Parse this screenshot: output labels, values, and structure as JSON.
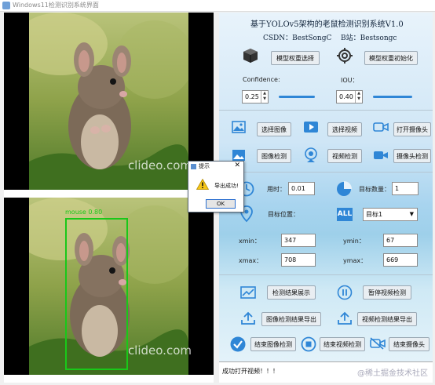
{
  "window": {
    "title": "Windows11检测识别系统界面"
  },
  "header": {
    "title": "基于YOLOv5架构的老鼠检测识别系统V1.0",
    "csdn": "CSDN：BestSongC",
    "bilibili": "B站：Bestsongc"
  },
  "model": {
    "select_label": "模型权重选择",
    "init_label": "模型权重初始化"
  },
  "params": {
    "confidence_label": "Confidence:",
    "confidence_value": "0.25",
    "iou_label": "IOU：",
    "iou_value": "0.40"
  },
  "sources": {
    "image_label": "选择图像",
    "video_label": "选择视频",
    "camera_label": "打开摄像头"
  },
  "detect": {
    "image_label": "图像检测",
    "video_label": "视频检测",
    "camera_label": "摄像头检测"
  },
  "stats": {
    "time_label": "用时：",
    "time_value": "0.01",
    "count_label": "目标数量：",
    "count_value": "1",
    "pos_label": "目标位置：",
    "target_select": "目标1"
  },
  "coords": {
    "xmin_label": "xmin：",
    "xmin_value": "347",
    "ymin_label": "ymin：",
    "ymin_value": "67",
    "xmax_label": "xmax：",
    "xmax_value": "708",
    "ymax_label": "ymax：",
    "ymax_value": "669"
  },
  "actions": {
    "show_result": "检测结果展示",
    "pause_video": "暂停视频检测",
    "export_image": "图像检测结果导出",
    "export_video": "视频检测结果导出",
    "end_image": "结束图像检测",
    "end_video": "结束视频检测",
    "end_camera": "结束摄像头"
  },
  "status": {
    "text": "成功打开视频！！！",
    "watermark": "@稀土掘金技术社区"
  },
  "images": {
    "watermark_top": "clideo.com",
    "watermark_bottom": "clideo.com",
    "detection_label": "mouse  0.80"
  },
  "dialog": {
    "title": "提示",
    "message": "导出成功!",
    "ok_label": "OK",
    "close": "✕"
  },
  "colors": {
    "accent": "#2f86d6",
    "bbox": "#19c819"
  }
}
